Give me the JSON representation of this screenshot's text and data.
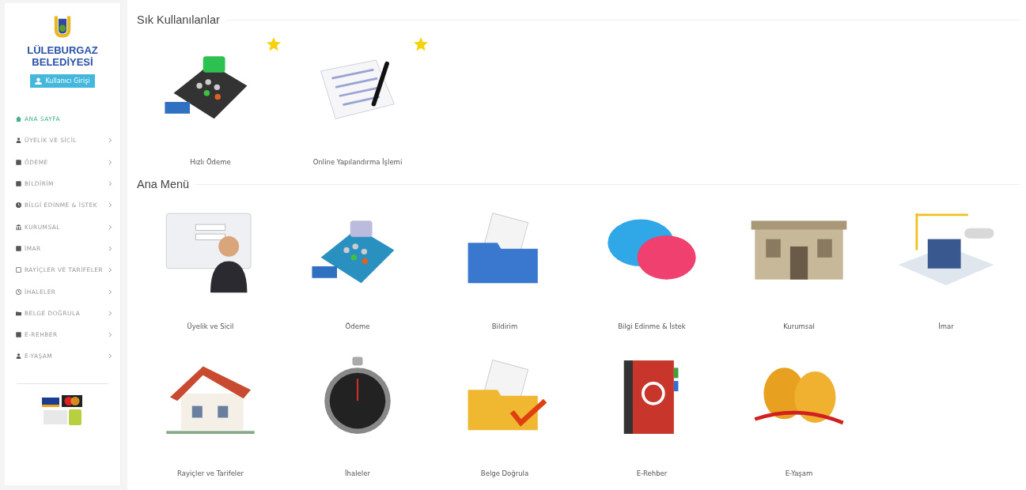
{
  "sidebar": {
    "logo_text": [
      "LÜLEBURGAZ",
      "BELEDİYESİ"
    ],
    "login_button": "Kullanıcı Girişi",
    "items": [
      {
        "label": "ANA SAYFA",
        "kind": "home",
        "selected": true,
        "has_submenu": false
      },
      {
        "label": "ÜYELİK VE SİCİL",
        "kind": "user",
        "selected": false,
        "has_submenu": true
      },
      {
        "label": "ÖDEME",
        "kind": "monitor",
        "selected": false,
        "has_submenu": true
      },
      {
        "label": "BİLDİRİM",
        "kind": "doc",
        "selected": false,
        "has_submenu": true
      },
      {
        "label": "BİLGİ EDİNME & İSTEK",
        "kind": "info",
        "selected": false,
        "has_submenu": true
      },
      {
        "label": "KURUMSAL",
        "kind": "bank",
        "selected": false,
        "has_submenu": true
      },
      {
        "label": "İMAR",
        "kind": "map",
        "selected": false,
        "has_submenu": true
      },
      {
        "label": "RAYİÇLER VE TARİFELER",
        "kind": "calc",
        "selected": false,
        "has_submenu": true
      },
      {
        "label": "İHALELER",
        "kind": "clock",
        "selected": false,
        "has_submenu": true
      },
      {
        "label": "BELGE DOĞRULA",
        "kind": "folder",
        "selected": false,
        "has_submenu": true
      },
      {
        "label": "E-REHBER",
        "kind": "book",
        "selected": false,
        "has_submenu": true
      },
      {
        "label": "E-YAŞAM",
        "kind": "person",
        "selected": false,
        "has_submenu": true
      }
    ]
  },
  "sections": [
    {
      "title": "Sık Kullanılanlar",
      "tiles": [
        {
          "label": "Hızlı Ödeme",
          "kind": "pos",
          "favorite": true
        },
        {
          "label": "Online Yapılandırma İşlemi",
          "kind": "document",
          "favorite": true
        }
      ]
    },
    {
      "title": "Ana Menü",
      "tiles": [
        {
          "label": "Üyelik ve Sicil",
          "kind": "login",
          "favorite": false
        },
        {
          "label": "Ödeme",
          "kind": "cardreader",
          "favorite": false
        },
        {
          "label": "Bildirim",
          "kind": "files",
          "favorite": false
        },
        {
          "label": "Bilgi Edinme & İstek",
          "kind": "chat",
          "favorite": false
        },
        {
          "label": "Kurumsal",
          "kind": "building",
          "favorite": false
        },
        {
          "label": "İmar",
          "kind": "blueprint",
          "favorite": false
        },
        {
          "label": "Rayiçler ve Tarifeler",
          "kind": "house",
          "favorite": false
        },
        {
          "label": "İhaleler",
          "kind": "stopwatch",
          "favorite": false
        },
        {
          "label": "Belge Doğrula",
          "kind": "foldercheck",
          "favorite": false
        },
        {
          "label": "E-Rehber",
          "kind": "addressbook",
          "favorite": false
        },
        {
          "label": "E-Yaşam",
          "kind": "masks",
          "favorite": false
        }
      ]
    }
  ]
}
